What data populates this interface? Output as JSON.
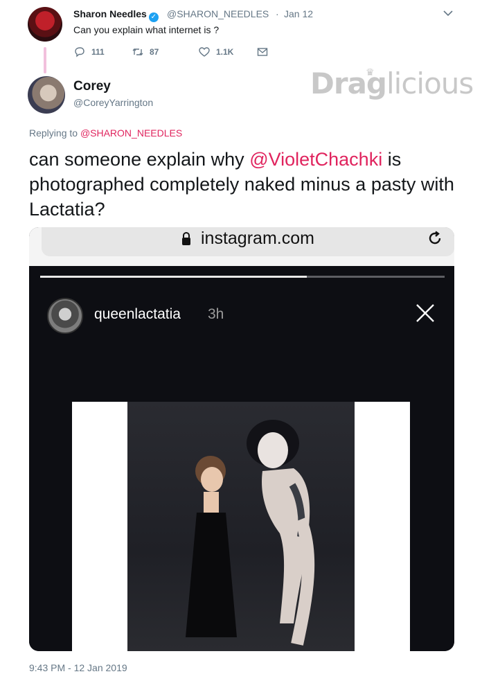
{
  "tweet1": {
    "name": "Sharon Needles",
    "verified_icon": "verified-badge-icon",
    "handle": "@SHARON_NEEDLES",
    "separator": "·",
    "date": "Jan 12",
    "text": "Can you explain what internet is ?",
    "actions": {
      "replies": "111",
      "retweets": "87",
      "likes": "1.1K"
    }
  },
  "tweet2": {
    "name": "Corey",
    "handle": "@CoreyYarrington",
    "replying_prefix": "Replying to ",
    "replying_to": "@SHARON_NEEDLES",
    "text_before": "can someone explain why ",
    "mention": "@VioletChachki",
    "text_after": " is photographed completely naked minus a pasty with Lactatia?",
    "timestamp": "9:43 PM - 12 Jan 2019"
  },
  "watermark": {
    "text": "DragLicious"
  },
  "media": {
    "browser": {
      "url": "instagram.com",
      "lock_icon": "lock-icon",
      "reload_icon": "reload-icon"
    },
    "story": {
      "username": "queenlactatia",
      "time": "3h",
      "progress": 0.66,
      "close_icon": "close-icon"
    }
  },
  "colors": {
    "mention": "#e0245e",
    "secondary_text": "#657786",
    "verified": "#1da1f2",
    "thread_line": "#f2c0dd"
  }
}
